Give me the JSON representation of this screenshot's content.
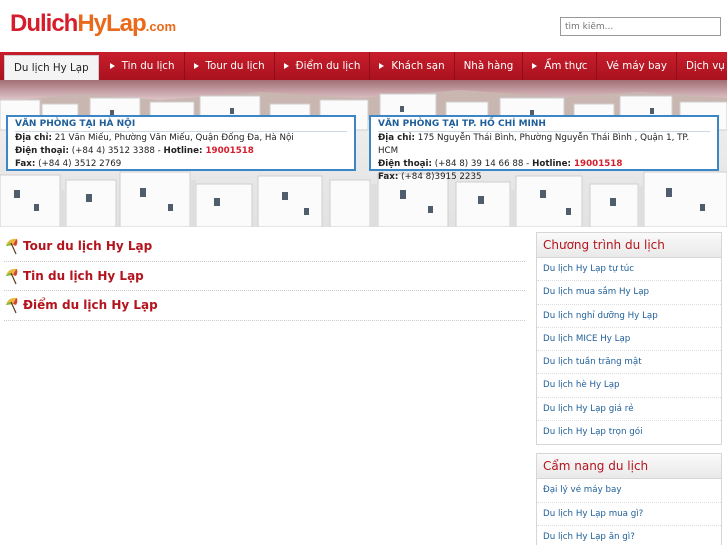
{
  "header": {
    "logo_part1": "Dulich",
    "logo_part2": "HyLap",
    "logo_part3": ".com",
    "search_placeholder": "tìm kiếm..."
  },
  "nav": {
    "items": [
      {
        "label": "Du lịch Hy Lạp",
        "active": true
      },
      {
        "label": "Tin du lịch",
        "arrow": true
      },
      {
        "label": "Tour du lịch",
        "arrow": true
      },
      {
        "label": "Điểm du lịch",
        "arrow": true
      },
      {
        "label": "Khách sạn",
        "arrow": true
      },
      {
        "label": "Nhà hàng"
      },
      {
        "label": "Ẩm thực",
        "arrow": true
      },
      {
        "label": "Vé máy bay"
      },
      {
        "label": "Dịch vụ Visa"
      }
    ]
  },
  "offices": {
    "hanoi": {
      "title": "VĂN PHÒNG TẠI HÀ NỘI",
      "address_label": "Địa chỉ:",
      "address": " 21 Văn Miếu, Phường Văn Miếu, Quận Đống Đa, Hà Nội",
      "phone_label": "Điện thoại:",
      "phone": " (+84 4) 3512 3388 - ",
      "hotline_label": "Hotline:",
      "hotline": " 19001518",
      "fax_label": "Fax:",
      "fax": " (+84 4) 3512 2769"
    },
    "hcm": {
      "title": "VĂN PHÒNG TẠI TP. HỒ CHÍ MINH",
      "address_label": "Địa chỉ:",
      "address": " 175 Nguyễn Thái Bình, Phường Nguyễn Thái Bình , Quận 1, TP. HCM",
      "phone_label": "Điện thoại:",
      "phone": " (+84 8) 39 14 66 88 - ",
      "hotline_label": "Hotline:",
      "hotline": " 19001518",
      "fax_label": "Fax:",
      "fax": " (+84 8)3915 2235"
    }
  },
  "content": {
    "categories": [
      "Tour du lịch Hy Lạp",
      "Tin du lịch Hy Lạp",
      "Điểm du lịch Hy Lạp"
    ]
  },
  "sidebar": {
    "programs": {
      "title": "Chương trình du lịch",
      "items": [
        "Du lịch Hy Lạp tự túc",
        "Du lịch mua sắm Hy Lạp",
        "Du lịch nghỉ dưỡng Hy Lạp",
        "Du lịch MICE Hy Lạp",
        "Du lịch tuần trăng mật",
        "Du lịch hè Hy Lạp",
        "Du lịch Hy Lạp giá rẻ",
        "Du lịch Hy Lạp trọn gói"
      ]
    },
    "handbook": {
      "title": "Cẩm nang du lịch",
      "items": [
        "Đại lý vé máy bay",
        "Du lịch Hy Lạp mua gì?",
        "Du lịch Hy Lạp ăn gì?"
      ]
    }
  },
  "colors": {
    "brand_red": "#c81e2c",
    "logo_orange": "#e96a1a",
    "link_blue": "#1f5f99",
    "office_border": "#3b86c6"
  },
  "icons": {
    "category_icon": "beach-umbrella-icon"
  }
}
